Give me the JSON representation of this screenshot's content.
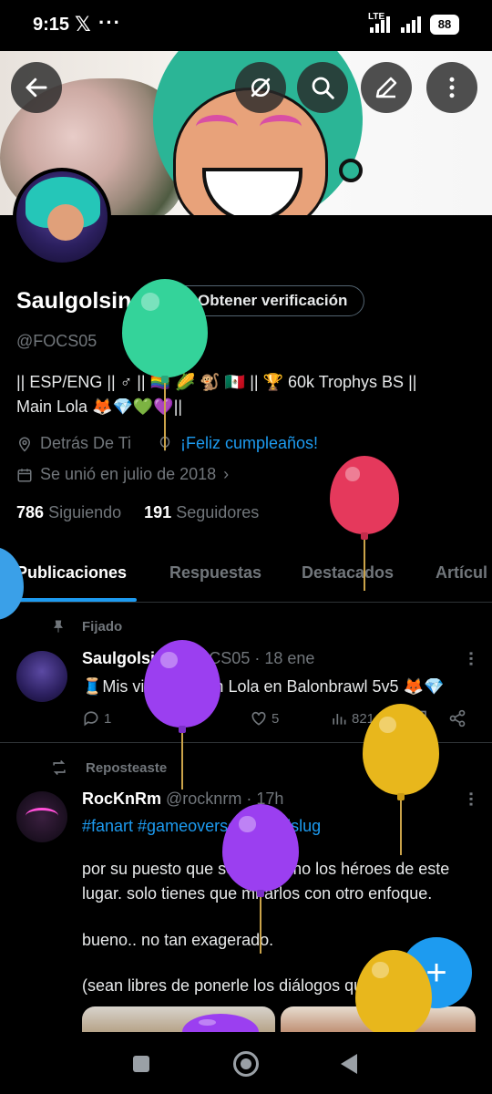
{
  "status_bar": {
    "time": "9:15",
    "network": "LTE",
    "battery": "88"
  },
  "header": {
    "back_icon": "arrow-left-icon",
    "grok_icon": "grok-icon",
    "search_icon": "search-icon",
    "edit_icon": "edit-icon",
    "more_icon": "more-vertical-icon"
  },
  "profile": {
    "name": "Saulgolsin",
    "verify_label": "Obtener verificación",
    "handle": "@FOCS05",
    "bio_line1": "|| ESP/ENG || ♂ || 🏳️‍🌈 🌽 🐒 🇲🇽 || 🏆 60k Trophys BS ||",
    "bio_line2": "Main Lola 🦊💎💚💜||",
    "location": "Detrás De Ti",
    "birthday": "¡Feliz cumpleaños!",
    "joined": "Se unió en julio de 2018",
    "following_count": "786",
    "following_label": "Siguiendo",
    "followers_count": "191",
    "followers_label": "Seguidores"
  },
  "tabs": [
    "Publicaciones",
    "Respuestas",
    "Destacados",
    "Artícul"
  ],
  "pinned_post": {
    "context": "Fijado",
    "author": "Saulgolsin",
    "handle": "@FOCS05",
    "time": "· 18 ene",
    "text": "🧵Mis victorias con Lola en Balonbrawl 5v5 🦊💎",
    "replies": "1",
    "likes": "5",
    "views": "821"
  },
  "repost": {
    "context": "Reposteaste",
    "author": "RocKnRm",
    "handle": "@rocknrm",
    "time": "· 17h",
    "hashtags": "#fanart #gameoverse #metalslug",
    "p1": "por su puesto que se ven como los héroes de este lugar. solo tienes que mirarlos con otro enfoque.",
    "p2": "bueno.. no tan exagerado.",
    "p3": "(sean libres de ponerle los diálogos que d"
  },
  "fab_label": "+",
  "colors": {
    "accent": "#1d9bf0",
    "muted": "#71767b",
    "background": "#000000"
  }
}
